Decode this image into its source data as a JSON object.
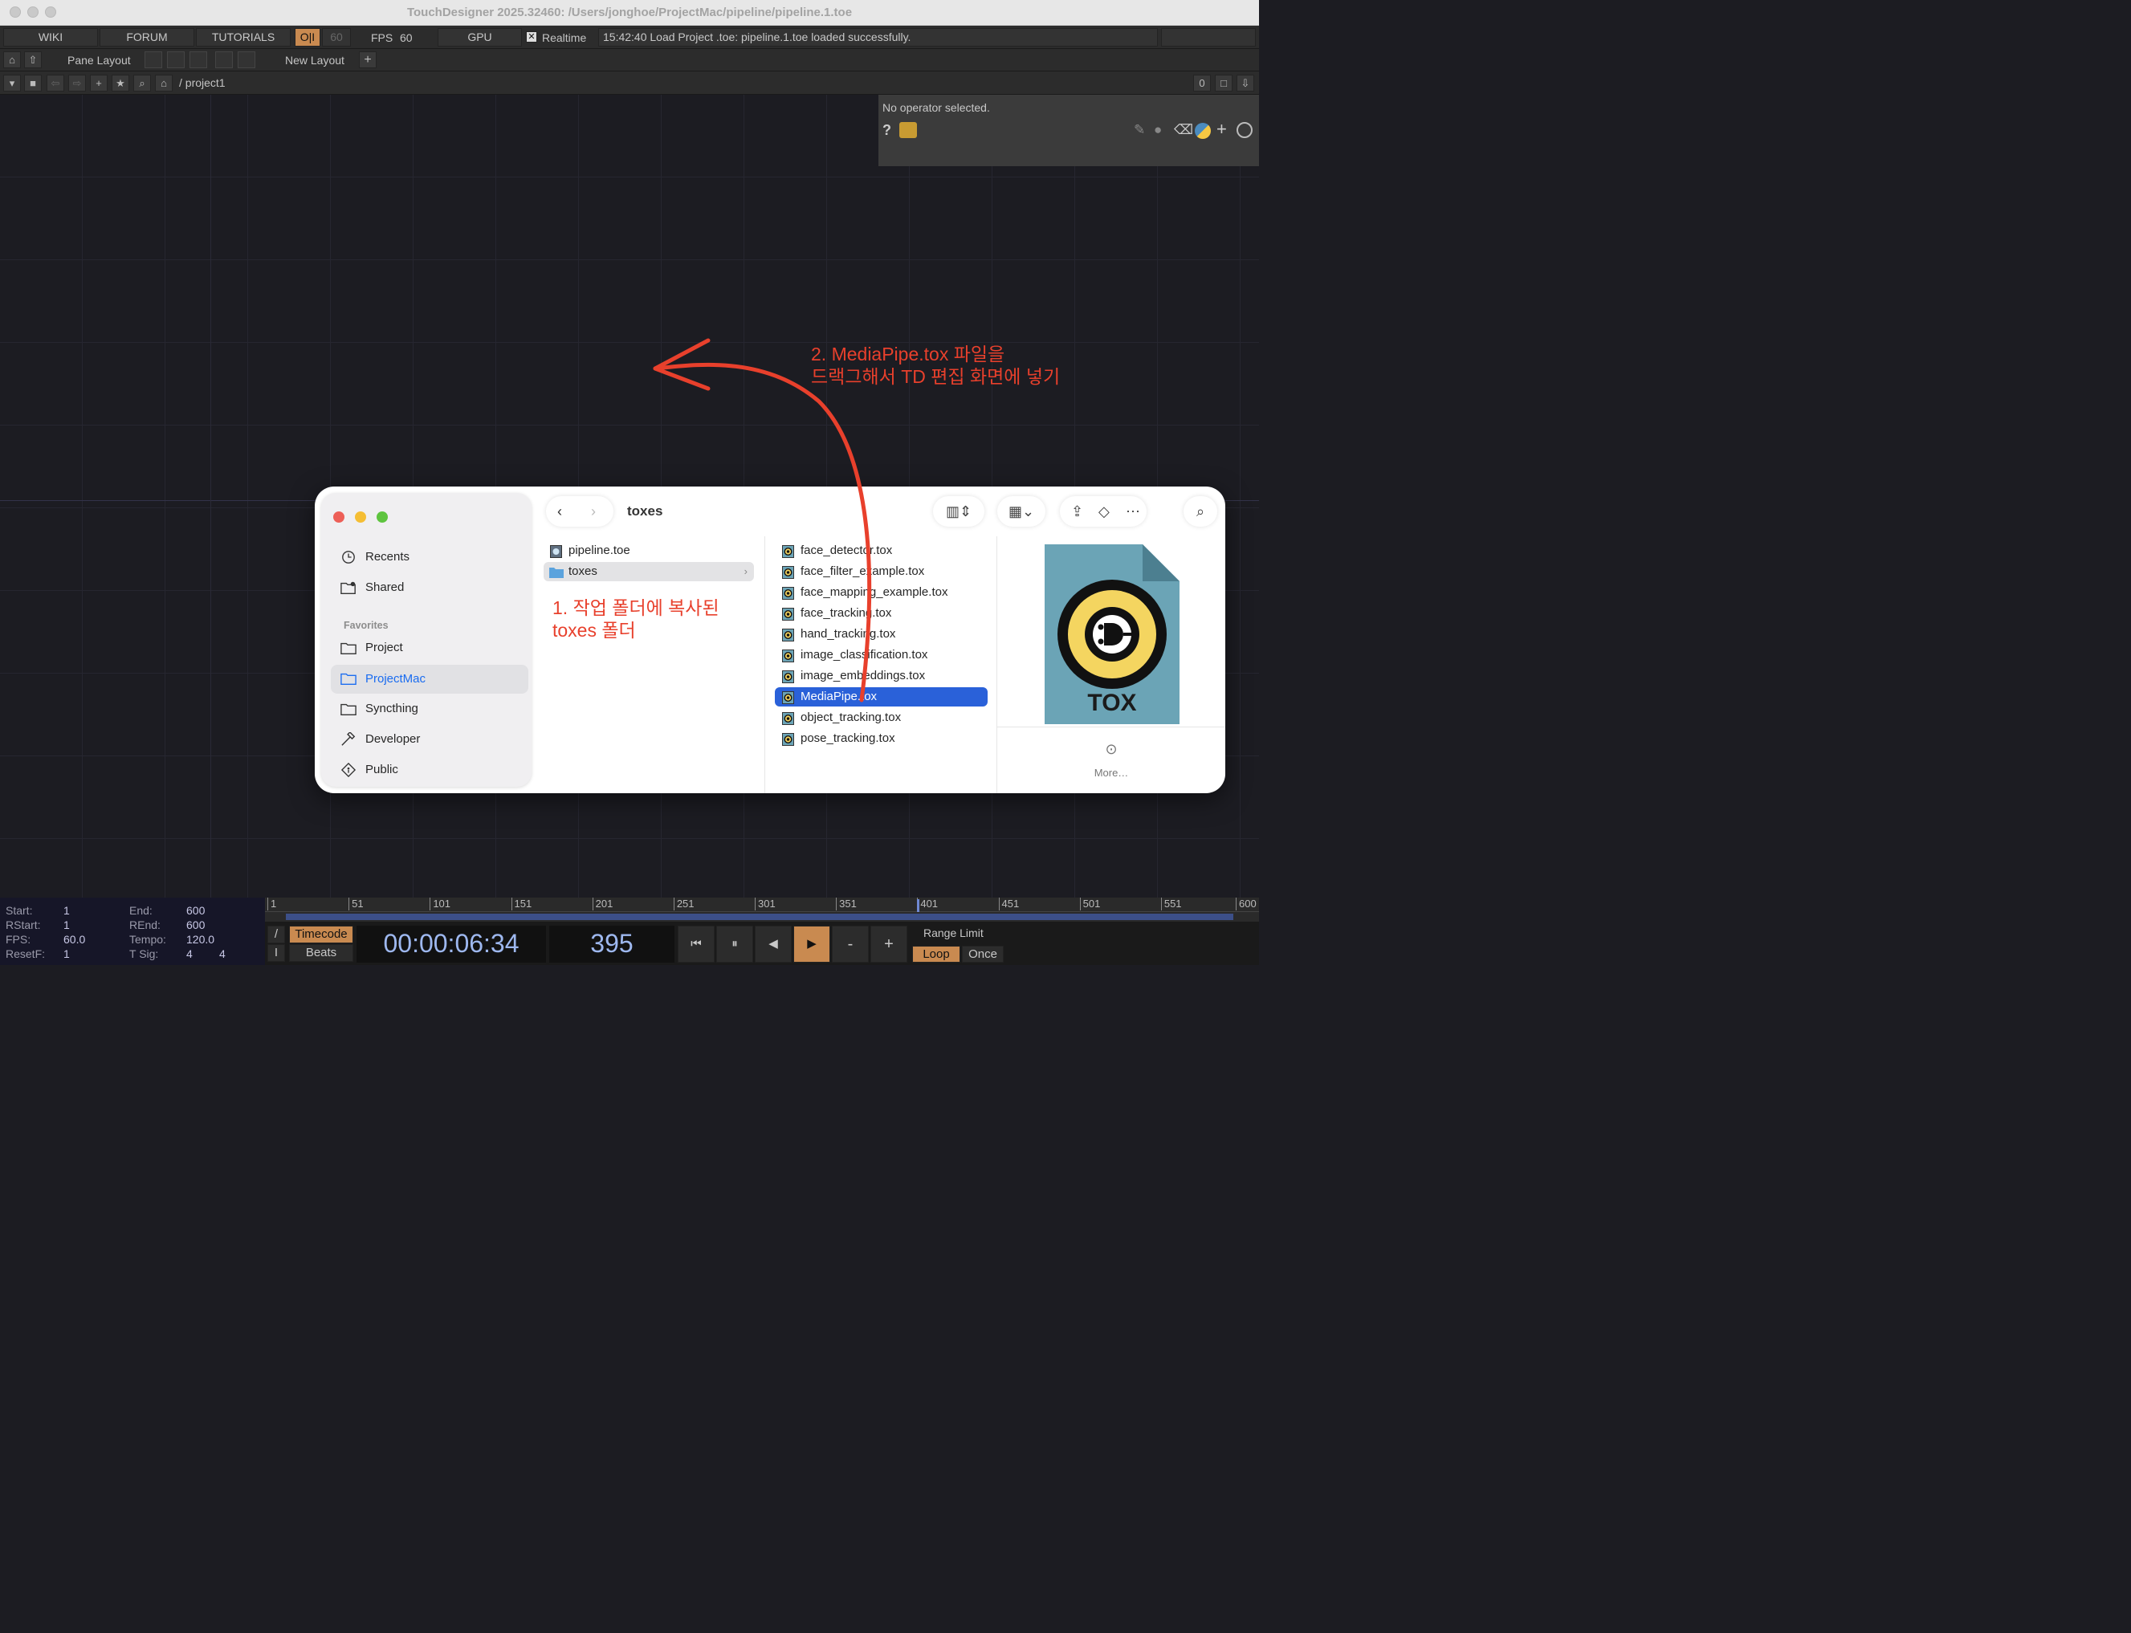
{
  "window": {
    "title": "TouchDesigner 2025.32460: /Users/jonghoe/ProjectMac/pipeline/pipeline.1.toe"
  },
  "toolbar": {
    "wiki": "WIKI",
    "forum": "FORUM",
    "tutorials": "TUTORIALS",
    "oi": "O|I",
    "sixty": "60",
    "fps_label": "FPS",
    "fps_value": "60",
    "gpu": "GPU",
    "realtime_check": "✕",
    "realtime": "Realtime",
    "status": "15:42:40 Load Project .toe: pipeline.1.toe loaded successfully."
  },
  "layout_bar": {
    "pane_layout": "Pane Layout",
    "new_layout": "New Layout",
    "add": "+"
  },
  "path_bar": {
    "path": "/ project1",
    "count": "0"
  },
  "params": {
    "message": "No operator selected.",
    "help": "?"
  },
  "annotations": {
    "drag_line1": "2. MediaPipe.tox 파일을",
    "drag_line2": "드랙그해서 TD 편집 화면에 넣기",
    "folder_line1": "1. 작업 폴더에 복사된",
    "folder_line2": "toxes 폴더"
  },
  "finder": {
    "title": "toxes",
    "sidebar": {
      "recents": "Recents",
      "shared": "Shared",
      "favorites": "Favorites",
      "project": "Project",
      "projectmac": "ProjectMac",
      "syncthing": "Syncthing",
      "developer": "Developer",
      "public": "Public"
    },
    "col1": [
      "pipeline.toe",
      "toxes"
    ],
    "col2": [
      "face_detector.tox",
      "face_filter_example.tox",
      "face_mapping_example.tox",
      "face_tracking.tox",
      "hand_tracking.tox",
      "image_classification.tox",
      "image_embeddings.tox",
      "MediaPipe.tox",
      "object_tracking.tox",
      "pose_tracking.tox"
    ],
    "preview_label": "TOX",
    "more": "More…"
  },
  "timeline": {
    "labels": {
      "start": "Start:",
      "rstart": "RStart:",
      "fps": "FPS:",
      "resetf": "ResetF:",
      "end": "End:",
      "rend": "REnd:",
      "tempo": "Tempo:",
      "tsig": "T Sig:"
    },
    "values": {
      "start": "1",
      "rstart": "1",
      "fps": "60.0",
      "resetf": "1",
      "end": "600",
      "rend": "600",
      "tempo": "120.0",
      "tsig1": "4",
      "tsig2": "4"
    },
    "ticks": [
      "1",
      "51",
      "101",
      "151",
      "201",
      "251",
      "301",
      "351",
      "401",
      "451",
      "501",
      "551",
      "600"
    ],
    "timecode": "Timecode",
    "beats": "Beats",
    "slash": "/",
    "i": "I",
    "time": "00:00:06:34",
    "frame": "395",
    "range_limit": "Range Limit",
    "loop": "Loop",
    "once": "Once",
    "minus": "-",
    "plus": "+"
  }
}
